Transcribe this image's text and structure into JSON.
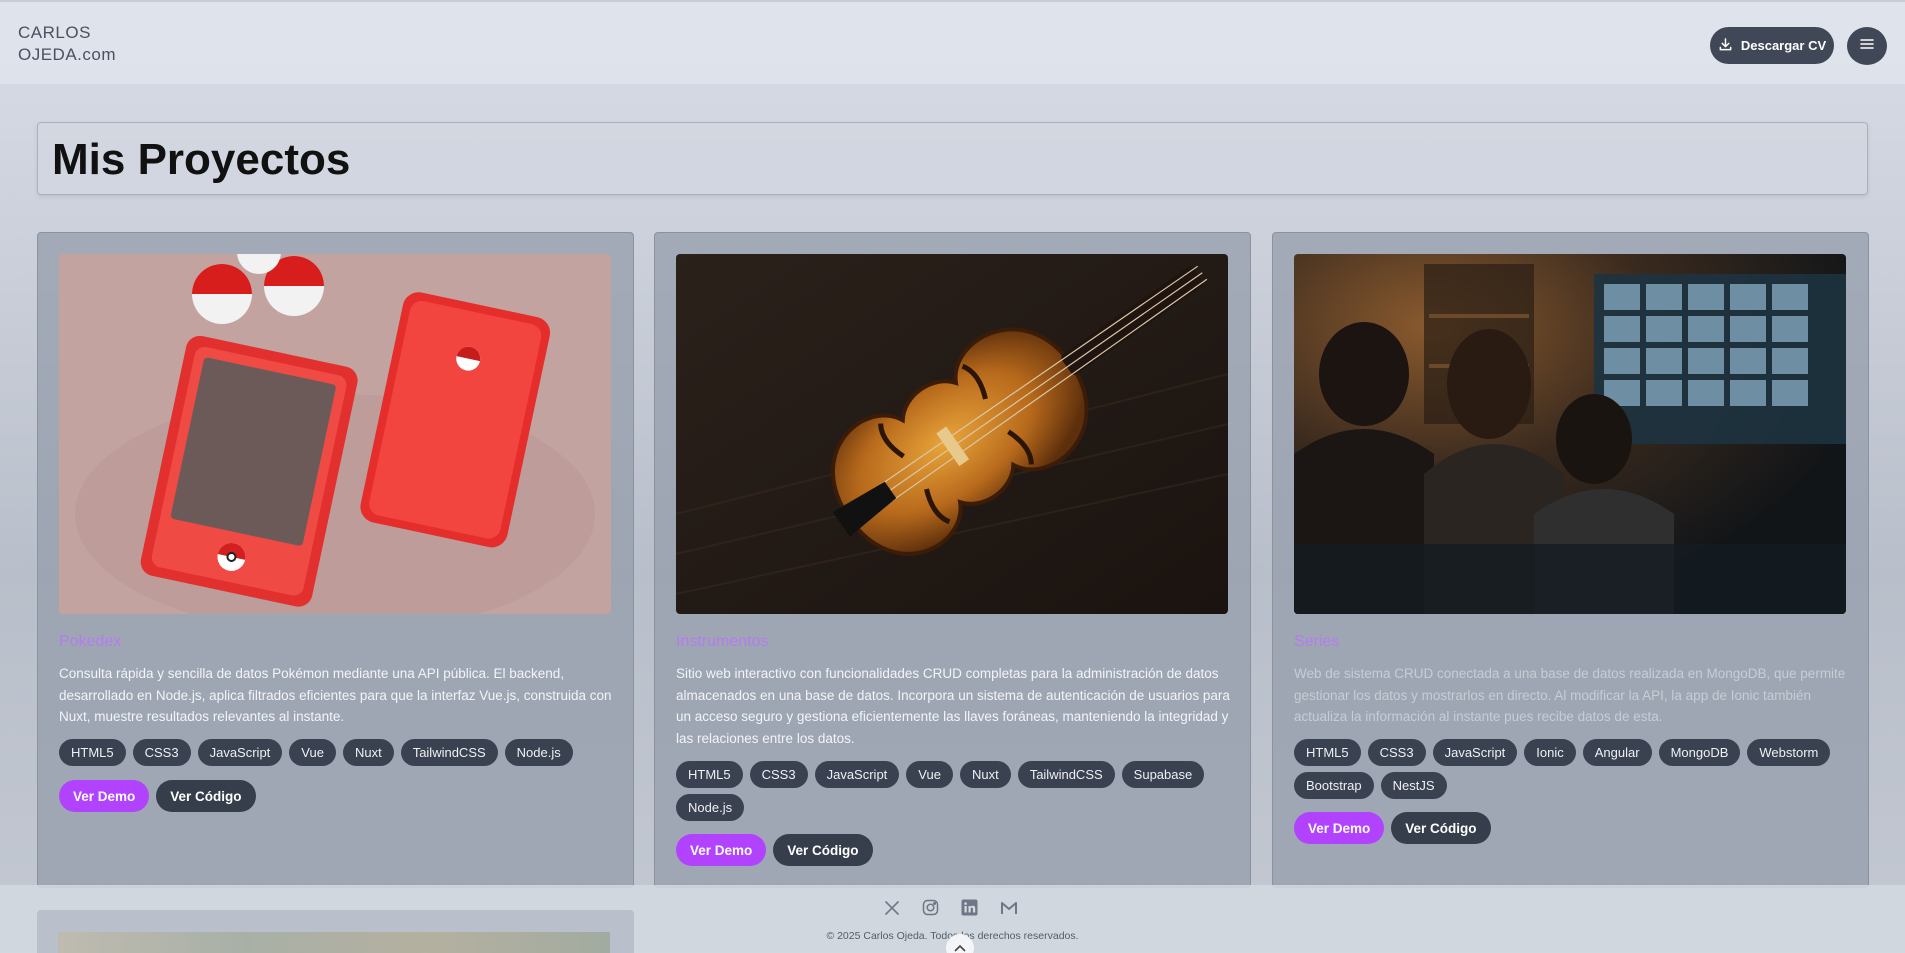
{
  "header": {
    "logo_line1": "CARLOS",
    "logo_line2": "OJEDA.com",
    "cv_button": "Descargar CV"
  },
  "page": {
    "title": "Mis Proyectos"
  },
  "projects": [
    {
      "name": "Pokedex",
      "description": "Consulta rápida y sencilla de datos Pokémon mediante una API pública. El backend, desarrollado en Node.js, aplica filtrados eficientes para que la interfaz Vue.js, construida con Nuxt, muestre resultados relevantes al instante.",
      "tags": [
        "HTML5",
        "CSS3",
        "JavaScript",
        "Vue",
        "Nuxt",
        "TailwindCSS",
        "Node.js"
      ],
      "demo": "Ver Demo",
      "code": "Ver Código"
    },
    {
      "name": "Instrumentos",
      "description": "Sitio web interactivo con funcionalidades CRUD completas para la administración de datos almacenados en una base de datos. Incorpora un sistema de autenticación de usuarios para un acceso seguro y gestiona eficientemente las llaves foráneas, manteniendo la integridad y las relaciones entre los datos.",
      "tags": [
        "HTML5",
        "CSS3",
        "JavaScript",
        "Vue",
        "Nuxt",
        "TailwindCSS",
        "Supabase",
        "Node.js"
      ],
      "demo": "Ver Demo",
      "code": "Ver Código"
    },
    {
      "name": "Series",
      "description": "Web de sistema CRUD conectada a una base de datos realizada en MongoDB, que permite gestionar los datos y mostrarlos en directo. Al modificar la API, la app de Ionic también actualiza la información al instante pues recibe datos de esta.",
      "tags": [
        "HTML5",
        "CSS3",
        "JavaScript",
        "Ionic",
        "Angular",
        "MongoDB",
        "Webstorm",
        "Bootstrap",
        "NestJS"
      ],
      "demo": "Ver Demo",
      "code": "Ver Código"
    }
  ],
  "footer": {
    "copyright": "© 2025 Carlos Ojeda. Todos los derechos reservados.",
    "social_icons": [
      "x-icon",
      "instagram-icon",
      "linkedin-icon",
      "gmail-icon"
    ]
  },
  "colors": {
    "accent": "#b143ff",
    "project_name": "#b57bf0",
    "dark_button": "#363d4b"
  }
}
